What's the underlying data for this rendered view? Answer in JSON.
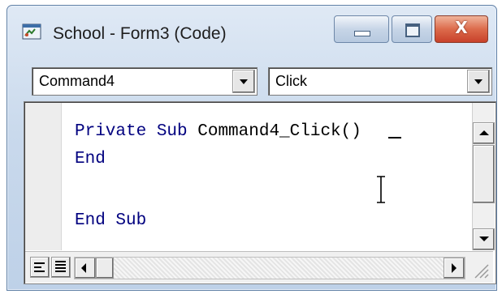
{
  "window": {
    "title": "School - Form3 (Code)",
    "icon": "code-window-icon",
    "controls": {
      "minimize_icon": "minimize-icon",
      "maximize_icon": "maximize-icon",
      "close_icon": "close-icon",
      "close_glyph": "X"
    }
  },
  "object_combo": {
    "value": "Command4"
  },
  "procedure_combo": {
    "value": "Click"
  },
  "code": {
    "line1_keywords": "Private Sub ",
    "line1_ident": "Command4_Click()",
    "line2": "End",
    "line3": "End Sub"
  },
  "colors": {
    "keyword": "#00007f",
    "title_bar": "#c9d9ec",
    "close_button": "#dc6b4c"
  }
}
